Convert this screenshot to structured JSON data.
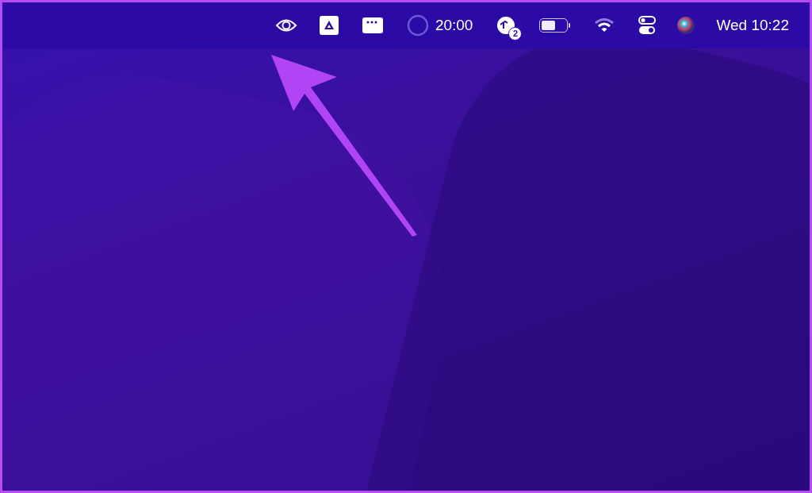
{
  "menu_bar": {
    "items": [
      {
        "kind": "eye"
      },
      {
        "kind": "drive"
      },
      {
        "kind": "window"
      },
      {
        "kind": "timer",
        "text": "20:00"
      },
      {
        "kind": "notifications",
        "badge": "2"
      },
      {
        "kind": "battery",
        "level": 0.55
      },
      {
        "kind": "wifi"
      },
      {
        "kind": "control"
      },
      {
        "kind": "siri"
      },
      {
        "kind": "clock",
        "text": "Wed 10:22"
      }
    ]
  }
}
